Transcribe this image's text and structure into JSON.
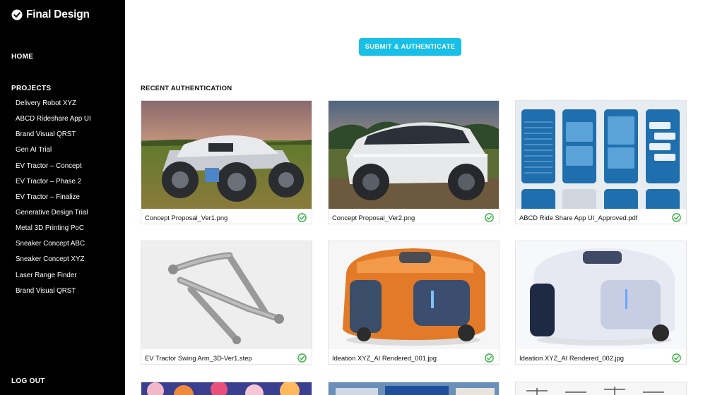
{
  "app": {
    "title": "Final Design"
  },
  "sidebar": {
    "home_label": "HOME",
    "projects_label": "PROJECTS",
    "projects": [
      "Delivery Robot XYZ",
      "ABCD Rideshare App UI",
      "Brand Visual QRST",
      "Gen AI Trial",
      "EV Tractor – Concept",
      "EV Tractor – Phase 2",
      "EV Tractor – Finalize",
      "Generative Design Trial",
      "Metal 3D Printing PoC",
      "Sneaker Concept ABC",
      "Sneaker Concept XYZ",
      "Laser Range Finder",
      "Brand Visual QRST"
    ],
    "logout_label": "LOG OUT"
  },
  "main": {
    "submit_label": "SUBMIT & AUTHENTICATE",
    "section_title": "RECENT AUTHENTICATION",
    "cards": [
      {
        "filename": "Concept Proposal_Ver1.png",
        "status": "authenticated"
      },
      {
        "filename": "Concept Proposal_Ver2.png",
        "status": "authenticated"
      },
      {
        "filename": "ABCD Ride Share App UI_Approved.pdf",
        "status": "authenticated"
      },
      {
        "filename": "EV Tractor Swing Arm_3D-Ver1.step",
        "status": "authenticated"
      },
      {
        "filename": "Ideation XYZ_AI Rendered_001.jpg",
        "status": "authenticated"
      },
      {
        "filename": "Ideation XYZ_AI Rendered_002.jpg",
        "status": "authenticated"
      }
    ]
  },
  "colors": {
    "accent": "#18bfe6",
    "check": "#3db34a",
    "sidebar_bg": "#000000"
  }
}
